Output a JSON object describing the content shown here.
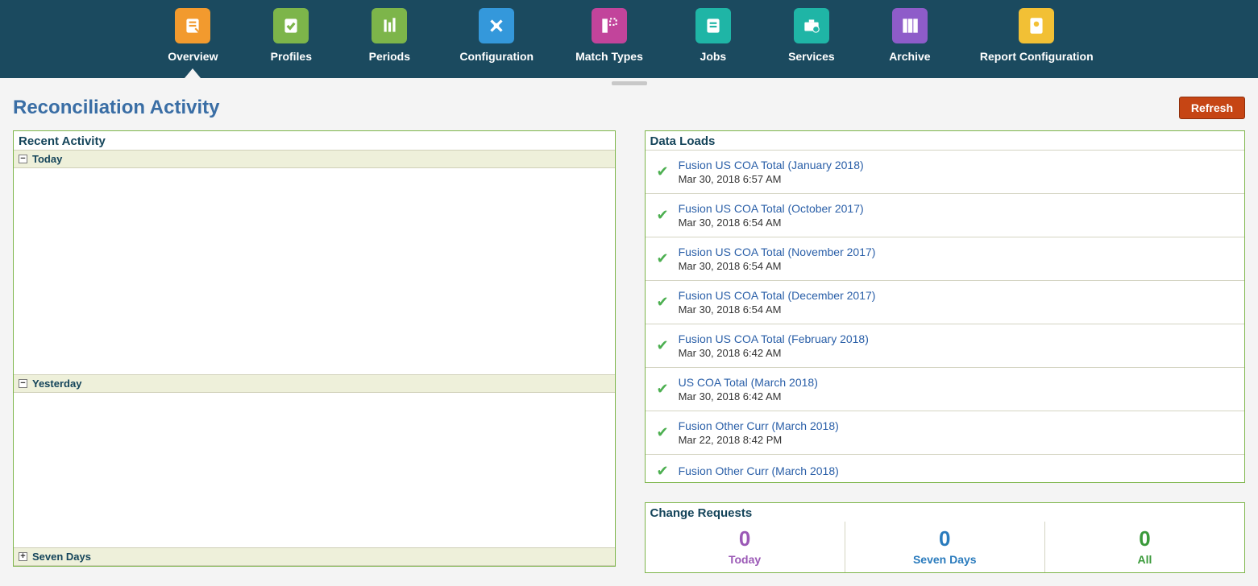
{
  "nav": {
    "items": [
      {
        "label": "Overview",
        "name": "nav-overview",
        "color": "#f29a2e",
        "active": true
      },
      {
        "label": "Profiles",
        "name": "nav-profiles",
        "color": "#7db54a"
      },
      {
        "label": "Periods",
        "name": "nav-periods",
        "color": "#7db54a"
      },
      {
        "label": "Configuration",
        "name": "nav-configuration",
        "color": "#3498db"
      },
      {
        "label": "Match Types",
        "name": "nav-match-types",
        "color": "#c2449b"
      },
      {
        "label": "Jobs",
        "name": "nav-jobs",
        "color": "#1fb5a6"
      },
      {
        "label": "Services",
        "name": "nav-services",
        "color": "#1fb5a6"
      },
      {
        "label": "Archive",
        "name": "nav-archive",
        "color": "#8e5cc9"
      },
      {
        "label": "Report\nConfiguration",
        "name": "nav-report-configuration",
        "color": "#f2c035"
      }
    ]
  },
  "page_title": "Reconciliation Activity",
  "refresh_label": "Refresh",
  "recent_activity": {
    "title": "Recent Activity",
    "sections": [
      {
        "label": "Today",
        "collapse": "-"
      },
      {
        "label": "Yesterday",
        "collapse": "-"
      },
      {
        "label": "Seven Days",
        "collapse": "+"
      }
    ]
  },
  "data_loads": {
    "title": "Data Loads",
    "items": [
      {
        "title": "Fusion US COA Total (January 2018)",
        "date": "Mar 30, 2018 6:57 AM"
      },
      {
        "title": "Fusion US COA Total (October 2017)",
        "date": "Mar 30, 2018 6:54 AM"
      },
      {
        "title": "Fusion US COA Total (November 2017)",
        "date": "Mar 30, 2018 6:54 AM"
      },
      {
        "title": "Fusion US COA Total (December 2017)",
        "date": "Mar 30, 2018 6:54 AM"
      },
      {
        "title": "Fusion US COA Total (February 2018)",
        "date": "Mar 30, 2018 6:42 AM"
      },
      {
        "title": "US COA Total (March 2018)",
        "date": "Mar 30, 2018 6:42 AM"
      },
      {
        "title": "Fusion Other Curr (March 2018)",
        "date": "Mar 22, 2018 8:42 PM"
      },
      {
        "title": "Fusion Other Curr (March 2018)",
        "date": ""
      }
    ]
  },
  "change_requests": {
    "title": "Change Requests",
    "cols": [
      {
        "count": "0",
        "label": "Today",
        "class": "c-today"
      },
      {
        "count": "0",
        "label": "Seven Days",
        "class": "c-seven"
      },
      {
        "count": "0",
        "label": "All",
        "class": "c-all"
      }
    ]
  }
}
